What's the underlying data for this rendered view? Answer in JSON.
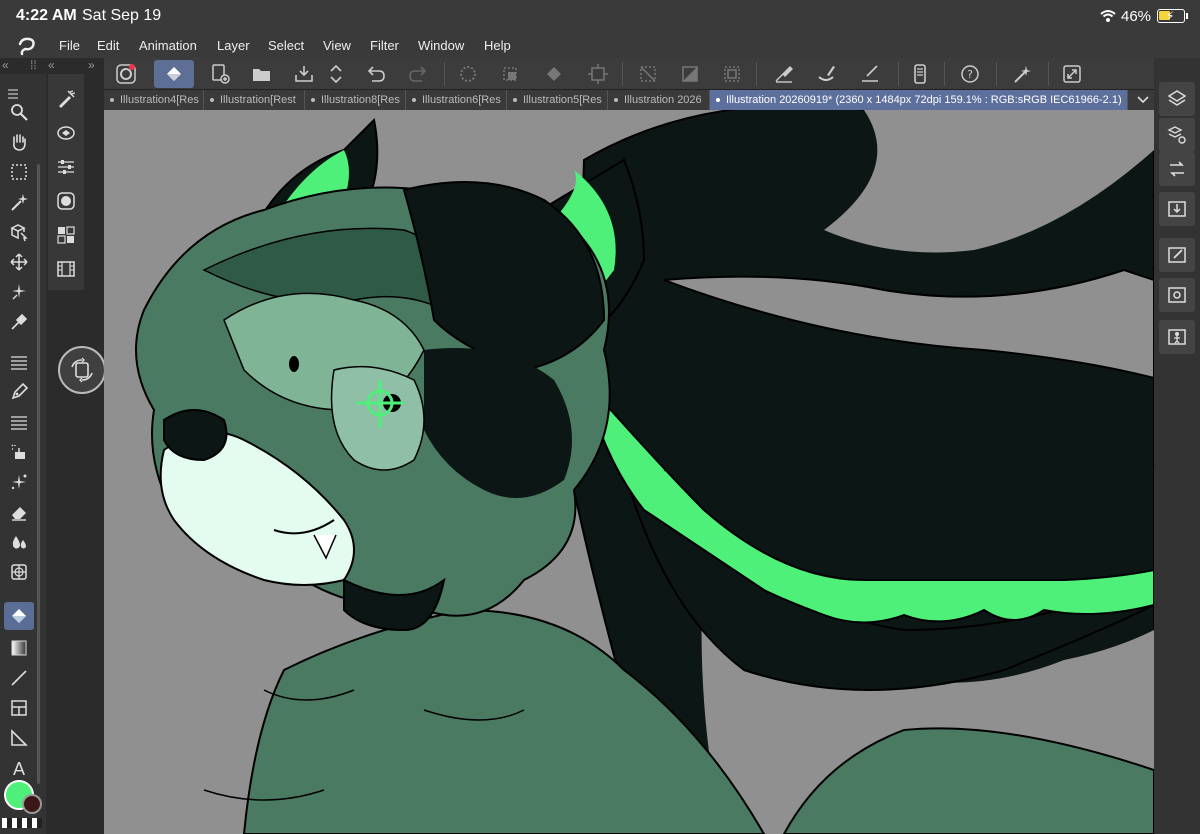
{
  "status_bar": {
    "time": "4:22 AM",
    "date": "Sat Sep 19",
    "battery_percent": "46%",
    "battery_level": 0.46,
    "icons": [
      "wifi-icon",
      "battery-icon"
    ]
  },
  "menu": {
    "logo_icon": "clip-studio-logo-icon",
    "items": [
      "File",
      "Edit",
      "Animation",
      "Layer",
      "Select",
      "View",
      "Filter",
      "Window",
      "Help"
    ]
  },
  "command_bar": {
    "icons": [
      "clip-studio-home-icon",
      "fill-tool-active-icon",
      "new-file-icon",
      "open-folder-icon",
      "save-icon",
      "resize-arrows-icon",
      "undo-icon",
      "redo-icon",
      "loading-spinner-icon",
      "crop-icon",
      "fill-icon",
      "transform-icon",
      "deselect-icon",
      "clear-icon",
      "invert-selection-icon",
      "convert-icon",
      "pen-stroke-icon",
      "brush-stroke-icon",
      "ruler-icon",
      "smartphone-icon",
      "help-icon",
      "magic-wand-icon",
      "fullscreen-icon"
    ],
    "active_index": 1
  },
  "tabs": [
    {
      "label": "Illustration4[Res"
    },
    {
      "label": "Illustration[Rest"
    },
    {
      "label": "Illustration8[Res"
    },
    {
      "label": "Illustration6[Res"
    },
    {
      "label": "Illustration5[Res"
    },
    {
      "label": "Illustration 2026"
    },
    {
      "label": "Illustration 20260919* (2360 x 1484px 72dpi 159.1% : RGB:sRGB IEC61966-2.1)",
      "active": true
    }
  ],
  "left_tools": {
    "items": [
      "zoom-icon",
      "hand-icon",
      "marquee-icon",
      "auto-select-icon",
      "object-icon",
      "move-icon",
      "sparkle-icon",
      "eyedropper-icon",
      "menu-lines-icon",
      "pen-icon",
      "brush-lines-icon",
      "airbrush-icon",
      "decoration-icon",
      "eraser-icon",
      "blend-icon",
      "figure-icon",
      "fill-icon",
      "gradient-icon",
      "line-icon",
      "frame-icon",
      "ruler-icon",
      "text-icon"
    ],
    "active": "fill-icon"
  },
  "subtools": [
    "sub-tool-brush-icon",
    "layer-property-icon",
    "tool-property-icon",
    "color-circle-icon",
    "color-set-icon",
    "timeline-icon"
  ],
  "colors": {
    "main": "#4ff07a",
    "sub": "#3b1818"
  },
  "right_panel": [
    "layers-icon",
    "layer-property-icon",
    "history-icon",
    "import-icon",
    "edit-icon",
    "material-icon",
    "figure-icon"
  ]
}
